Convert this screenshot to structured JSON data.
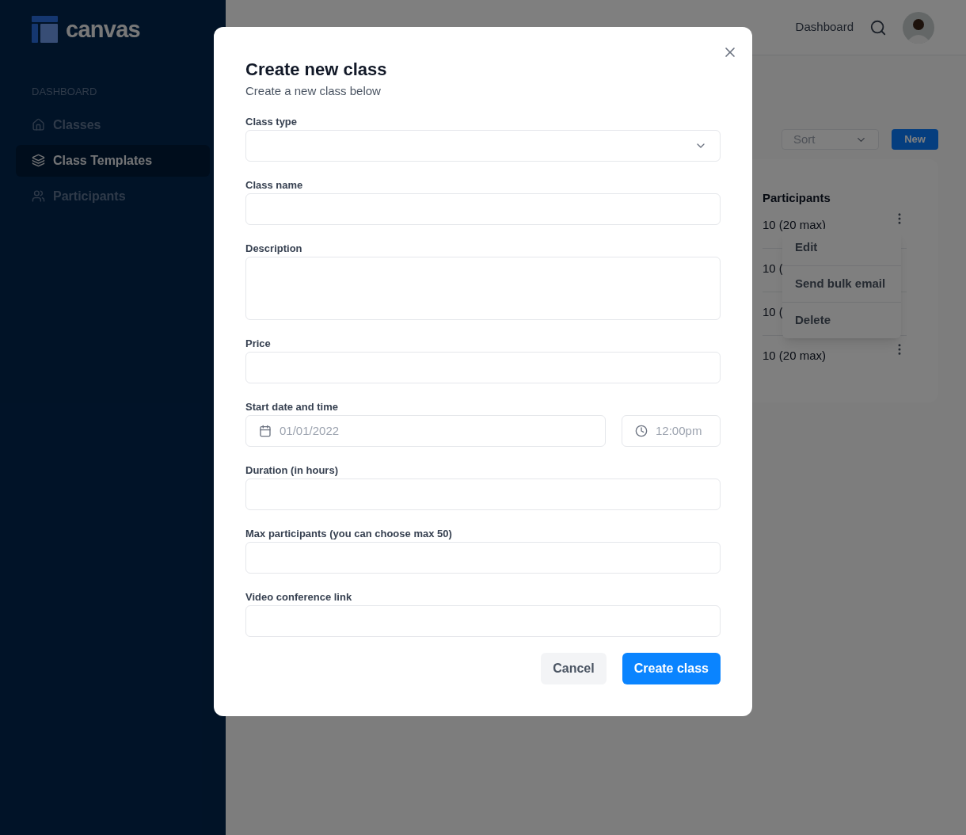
{
  "logo": {
    "text": "canvas"
  },
  "sidebar": {
    "section": "DASHBOARD",
    "items": [
      {
        "label": "Classes",
        "selected": false
      },
      {
        "label": "Class Templates",
        "selected": true
      },
      {
        "label": "Participants",
        "selected": false
      }
    ]
  },
  "topbar": {
    "link": "Dashboard"
  },
  "toolbar": {
    "sort": {
      "placeholder": "Sort"
    },
    "new_button": "New"
  },
  "table": {
    "columns": [
      "Participants"
    ],
    "rows": [
      {
        "participants": "10 (20 max)",
        "menu_button": true
      },
      {
        "participants": "10 ("
      },
      {
        "participants": "10 ("
      },
      {
        "participants": "10 (20 max)",
        "menu_button": true
      }
    ]
  },
  "context_menu": {
    "items": [
      "Edit",
      "Send bulk email",
      "Delete"
    ]
  },
  "dialog": {
    "title": "Create new class",
    "subtitle": "Create a new class below",
    "fields": [
      {
        "label": "Class type",
        "kind": "select"
      },
      {
        "label": "Class name",
        "kind": "text"
      },
      {
        "label": "Description",
        "kind": "textarea"
      },
      {
        "label": "Price",
        "kind": "text"
      },
      {
        "label": "Start date and time",
        "kind": "datetime",
        "date_placeholder": "01/01/2022",
        "time_placeholder": "12:00pm"
      },
      {
        "label": "Duration (in hours)",
        "kind": "text"
      },
      {
        "label": "Max participants (you can choose max 50)",
        "kind": "text"
      },
      {
        "label": "Video conference link",
        "kind": "text"
      }
    ],
    "buttons": [
      {
        "label": "Cancel",
        "kind": "secondary"
      },
      {
        "label": "Create class",
        "kind": "primary"
      }
    ]
  }
}
